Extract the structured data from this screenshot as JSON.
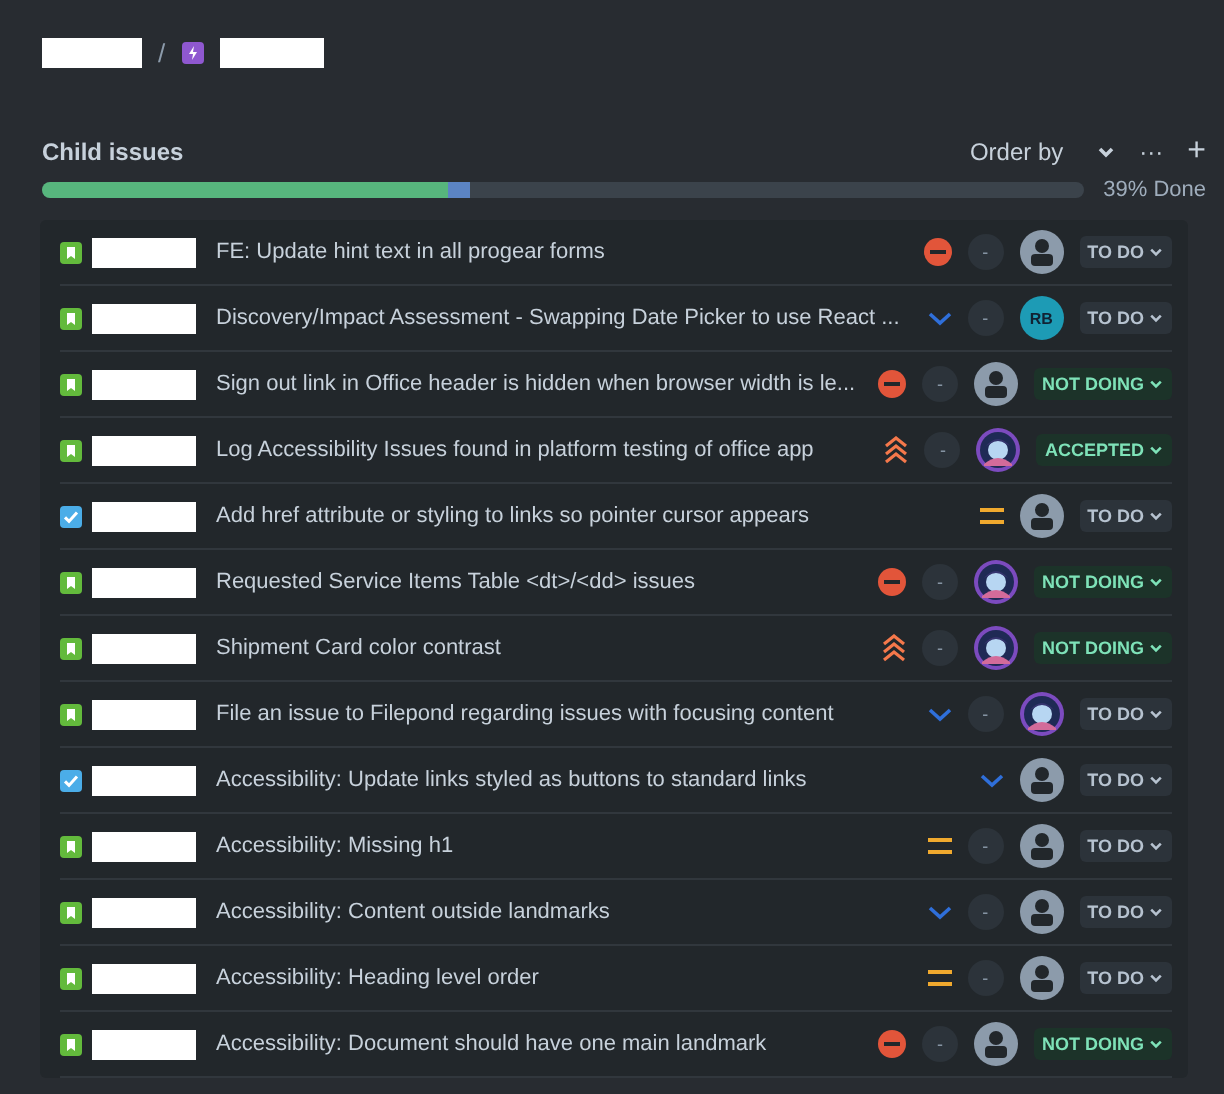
{
  "breadcrumb": {
    "separator": "/"
  },
  "child_issues": {
    "title": "Child issues",
    "order_by": "Order by",
    "more": "···",
    "add": "+",
    "progress": {
      "level": 0.39,
      "label": "39% Done"
    }
  },
  "issues": [
    {
      "kind": "story",
      "title": "FE: Update hint text in all progear forms",
      "priority": {
        "kind": "blocker"
      },
      "estimate": "-",
      "assignee": {
        "kind": "unassigned"
      },
      "status": {
        "label": "TO DO",
        "kind": "todo"
      }
    },
    {
      "kind": "story",
      "title": "Discovery/Impact Assessment - Swapping Date Picker to use React ...",
      "priority": {
        "kind": "low"
      },
      "estimate": "-",
      "assignee": {
        "kind": "initials",
        "initials": "RB"
      },
      "status": {
        "label": "TO DO",
        "kind": "todo"
      }
    },
    {
      "kind": "story",
      "title": "Sign out link in Office header is hidden when browser width is le...",
      "priority": {
        "kind": "blocker"
      },
      "estimate": "-",
      "assignee": {
        "kind": "unassigned"
      },
      "status": {
        "label": "NOT DOING",
        "kind": "done"
      }
    },
    {
      "kind": "story",
      "title": "Log Accessibility Issues found in platform testing of office app",
      "priority": {
        "kind": "highest"
      },
      "estimate": "-",
      "status": {
        "label": "ACCEPTED",
        "kind": "done"
      }
    },
    {
      "kind": "task",
      "title": "Add href attribute or styling to links so pointer cursor appears",
      "priority": {
        "kind": "medium"
      },
      "assignee": {
        "kind": "unassigned"
      },
      "status": {
        "label": "TO DO",
        "kind": "todo"
      }
    },
    {
      "kind": "story",
      "title": "Requested Service Items Table <dt>/<dd> issues",
      "priority": {
        "kind": "blocker"
      },
      "estimate": "-",
      "status": {
        "label": "NOT DOING",
        "kind": "done"
      }
    },
    {
      "kind": "story",
      "title": "Shipment Card color contrast",
      "priority": {
        "kind": "highest"
      },
      "estimate": "-",
      "status": {
        "label": "NOT DOING",
        "kind": "done"
      }
    },
    {
      "kind": "story",
      "title": "File an issue to Filepond regarding issues with focusing content",
      "priority": {
        "kind": "low"
      },
      "estimate": "-",
      "status": {
        "label": "TO DO",
        "kind": "todo"
      }
    },
    {
      "kind": "task",
      "title": "Accessibility: Update links styled as buttons to standard links",
      "priority": {
        "kind": "low"
      },
      "assignee": {
        "kind": "unassigned"
      },
      "status": {
        "label": "TO DO",
        "kind": "todo"
      }
    },
    {
      "kind": "story",
      "title": "Accessibility: Missing h1",
      "priority": {
        "kind": "medium"
      },
      "estimate": "-",
      "assignee": {
        "kind": "unassigned"
      },
      "status": {
        "label": "TO DO",
        "kind": "todo"
      }
    },
    {
      "kind": "story",
      "title": "Accessibility: Content outside landmarks",
      "priority": {
        "kind": "low"
      },
      "estimate": "-",
      "assignee": {
        "kind": "unassigned"
      },
      "status": {
        "label": "TO DO",
        "kind": "todo"
      }
    },
    {
      "kind": "story",
      "title": "Accessibility: Heading level order",
      "priority": {
        "kind": "medium"
      },
      "estimate": "-",
      "assignee": {
        "kind": "unassigned"
      },
      "status": {
        "label": "TO DO",
        "kind": "todo"
      }
    },
    {
      "kind": "story",
      "title": "Accessibility: Document should have one main landmark",
      "priority": {
        "kind": "blocker"
      },
      "estimate": "-",
      "assignee": {
        "kind": "unassigned"
      },
      "status": {
        "label": "NOT DOING",
        "kind": "done"
      }
    }
  ]
}
